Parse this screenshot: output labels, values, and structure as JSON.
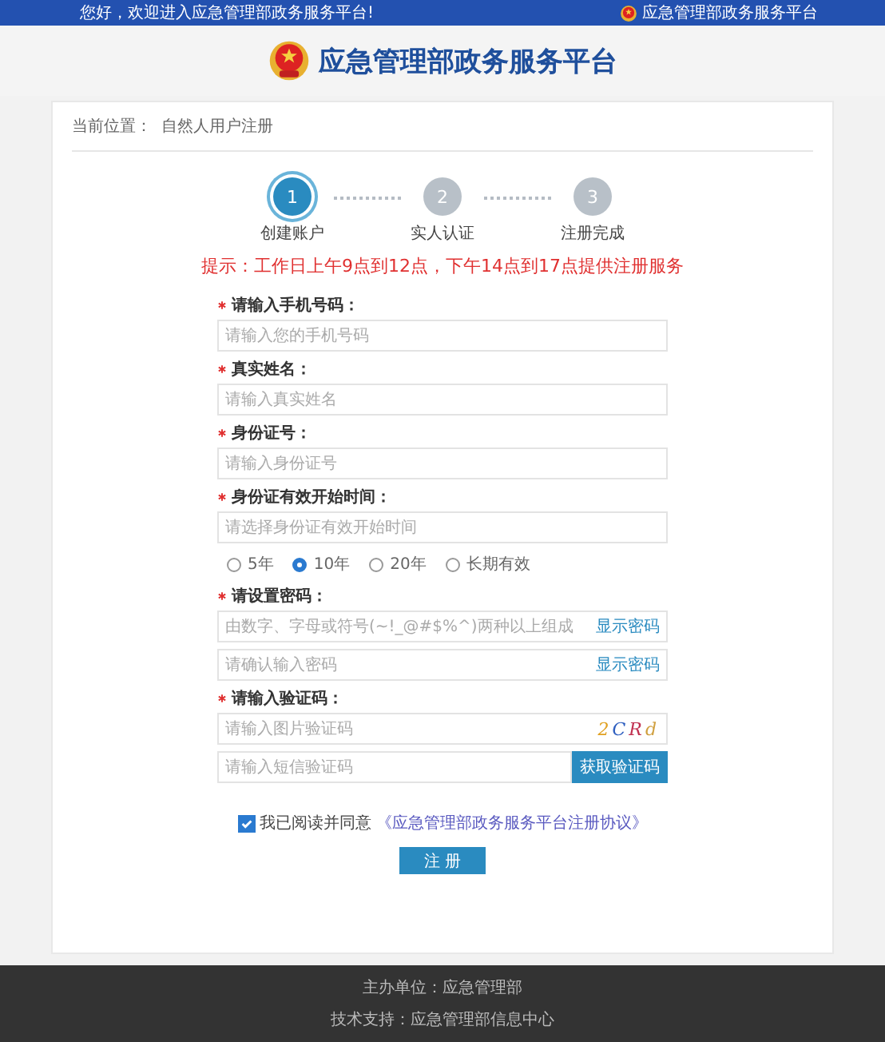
{
  "top_bar": {
    "welcome": "您好，欢迎进入应急管理部政务服务平台!",
    "site_link": "应急管理部政务服务平台"
  },
  "header": {
    "title": "应急管理部政务服务平台"
  },
  "breadcrumb": {
    "label": "当前位置：",
    "current": "自然人用户注册"
  },
  "steps": [
    {
      "number": "1",
      "label": "创建账户",
      "selected": true
    },
    {
      "number": "2",
      "label": "实人认证",
      "selected": false
    },
    {
      "number": "3",
      "label": "注册完成",
      "selected": false
    }
  ],
  "notice": "提示：工作日上午9点到12点，下午14点到17点提供注册服务",
  "form": [
    {
      "kind": "field",
      "label": "请输入手机号码：",
      "required": true,
      "placeholder": "请输入您的手机号码"
    },
    {
      "kind": "field",
      "label": "真实姓名：",
      "required": true,
      "placeholder": "请输入真实姓名"
    },
    {
      "kind": "field",
      "label": "身份证号：",
      "required": true,
      "placeholder": "请输入身份证号"
    },
    {
      "kind": "field",
      "label": "身份证有效开始时间：",
      "required": true,
      "placeholder": "请选择身份证有效开始时间"
    },
    {
      "kind": "radios",
      "options": [
        {
          "label": "5年",
          "selected": false
        },
        {
          "label": "10年",
          "selected": true
        },
        {
          "label": "20年",
          "selected": false
        },
        {
          "label": "长期有效",
          "selected": false
        }
      ]
    },
    {
      "kind": "field",
      "label": "请设置密码：",
      "required": true,
      "placeholder": "由数字、字母或符号(~!_@#$%^)两种以上组成",
      "toggle": "显示密码"
    },
    {
      "kind": "field",
      "placeholder": "请确认输入密码",
      "toggle": "显示密码"
    },
    {
      "kind": "field",
      "label": "请输入验证码：",
      "required": true,
      "placeholder": "请输入图片验证码",
      "captcha": "2CRd"
    },
    {
      "kind": "field",
      "placeholder": "请输入短信验证码",
      "button": "获取验证码"
    }
  ],
  "agreement": {
    "checked": true,
    "text": "我已阅读并同意",
    "link": "《应急管理部政务服务平台注册协议》"
  },
  "submit": "注 册",
  "footer": [
    "主办单位：应急管理部",
    "技术支持：应急管理部信息中心"
  ]
}
